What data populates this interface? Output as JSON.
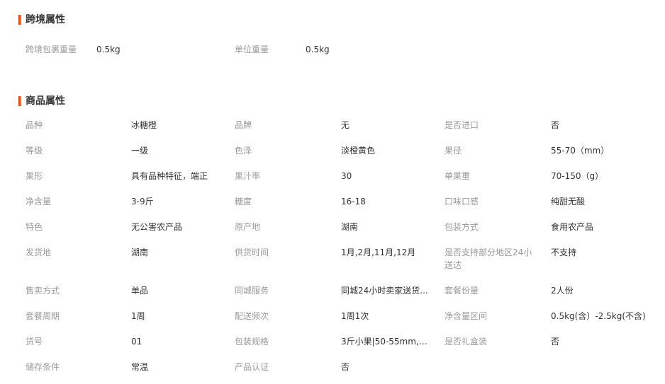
{
  "cross_border": {
    "title": "跨境属性",
    "items": [
      {
        "label": "跨境包裹重量",
        "value": "0.5kg"
      },
      {
        "label": "单位重量",
        "value": "0.5kg"
      }
    ]
  },
  "goods": {
    "title": "商品属性",
    "rows": [
      [
        {
          "label": "品种",
          "value": "冰糖橙"
        },
        {
          "label": "品牌",
          "value": "无"
        },
        {
          "label": "是否进口",
          "value": "否"
        }
      ],
      [
        {
          "label": "等级",
          "value": "一级"
        },
        {
          "label": "色泽",
          "value": "淡橙黄色"
        },
        {
          "label": "果径",
          "value": "55-70（mm）"
        }
      ],
      [
        {
          "label": "果形",
          "value": "具有品种特征，端正"
        },
        {
          "label": "果汁率",
          "value": "30"
        },
        {
          "label": "单果重",
          "value": "70-150（g）"
        }
      ],
      [
        {
          "label": "净含量",
          "value": "3-9斤"
        },
        {
          "label": "糖度",
          "value": "16-18"
        },
        {
          "label": "口味口感",
          "value": "纯甜无酸"
        }
      ],
      [
        {
          "label": "特色",
          "value": "无公害农产品"
        },
        {
          "label": "原产地",
          "value": "湖南"
        },
        {
          "label": "包装方式",
          "value": "食用农产品"
        }
      ],
      [
        {
          "label": "发货地",
          "value": "湖南"
        },
        {
          "label": "供货时间",
          "value": "1月,2月,11月,12月"
        },
        {
          "label": "是否支持部分地区24小送达",
          "value": "不支持"
        }
      ],
      [
        {
          "label": "售卖方式",
          "value": "单品"
        },
        {
          "label": "同城服务",
          "value": "同城24小时卖家送货..."
        },
        {
          "label": "套餐份量",
          "value": "2人份"
        }
      ],
      [
        {
          "label": "套餐周期",
          "value": "1周"
        },
        {
          "label": "配送频次",
          "value": "1周1次"
        },
        {
          "label": "净含量区间",
          "value": "0.5kg(含）-2.5kg(不含)"
        }
      ],
      [
        {
          "label": "货号",
          "value": "01"
        },
        {
          "label": "包装规格",
          "value": "3斤小果|50-55mm,3..."
        },
        {
          "label": "是否礼盒装",
          "value": "否"
        }
      ],
      [
        {
          "label": "储存条件",
          "value": "常温"
        },
        {
          "label": "产品认证",
          "value": "否"
        }
      ]
    ]
  },
  "colors": {
    "accent_bar": "#ff4400",
    "label_text": "#999999",
    "value_text": "#333333"
  }
}
